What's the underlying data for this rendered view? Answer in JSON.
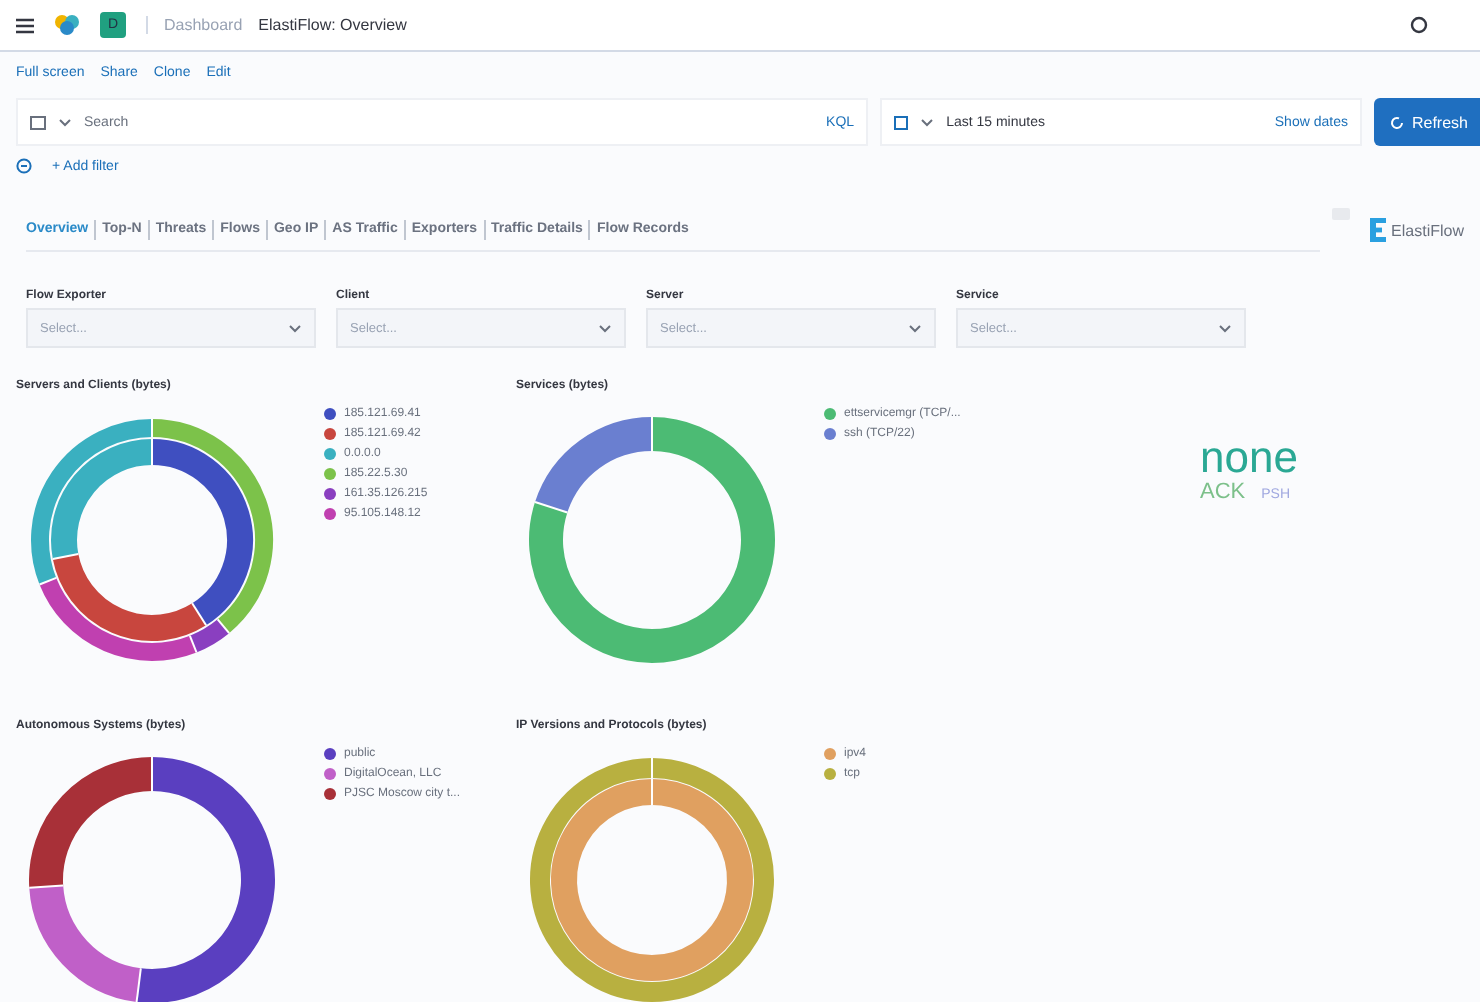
{
  "header": {
    "badge": "D",
    "breadcrumbs": [
      "Dashboard",
      "ElastiFlow: Overview"
    ]
  },
  "top_menu": [
    "Full screen",
    "Share",
    "Clone",
    "Edit"
  ],
  "query_bar": {
    "search_placeholder": "Search",
    "language": "KQL",
    "time_range": "Last 15 minutes",
    "show_dates": "Show dates",
    "refresh": "Refresh"
  },
  "filter_bar": {
    "add_filter": "+ Add filter"
  },
  "tabs": [
    {
      "label": "Overview",
      "selected": true
    },
    {
      "label": "Top-N",
      "selected": false
    },
    {
      "label": "Threats",
      "selected": false
    },
    {
      "label": "Flows",
      "selected": false
    },
    {
      "label": "Geo IP",
      "selected": false
    },
    {
      "label": "AS Traffic",
      "selected": false
    },
    {
      "label": "Exporters",
      "selected": false
    },
    {
      "label": "Traffic Details",
      "selected": false
    },
    {
      "label": "Flow Records",
      "selected": false
    }
  ],
  "brand": "ElastiFlow",
  "controls": [
    {
      "label": "Flow Exporter",
      "placeholder": "Select..."
    },
    {
      "label": "Client",
      "placeholder": "Select..."
    },
    {
      "label": "Server",
      "placeholder": "Select..."
    },
    {
      "label": "Service",
      "placeholder": "Select..."
    }
  ],
  "panels": [
    {
      "title": "Servers and Clients (bytes)",
      "legend": [
        {
          "label": "185.121.69.41",
          "color": "#3f4fc0"
        },
        {
          "label": "185.121.69.42",
          "color": "#c8463e"
        },
        {
          "label": "0.0.0.0",
          "color": "#3ab0c0"
        },
        {
          "label": "185.22.5.30",
          "color": "#7cc24a"
        },
        {
          "label": "161.35.126.215",
          "color": "#8a3fc0"
        },
        {
          "label": "95.105.148.12",
          "color": "#c040b0"
        }
      ]
    },
    {
      "title": "Services (bytes)",
      "legend": [
        {
          "label": "ettservicemgr (TCP/...",
          "color": "#4cbb74"
        },
        {
          "label": "ssh (TCP/22)",
          "color": "#6a7fd0"
        }
      ]
    },
    {
      "title": "Autonomous Systems (bytes)",
      "legend": [
        {
          "label": "public",
          "color": "#5a3fc0"
        },
        {
          "label": "DigitalOcean, LLC",
          "color": "#c060c8"
        },
        {
          "label": "PJSC Moscow city t...",
          "color": "#a83038"
        }
      ]
    },
    {
      "title": "IP Versions and Protocols (bytes)",
      "legend": [
        {
          "label": "ipv4",
          "color": "#e0a060"
        },
        {
          "label": "tcp",
          "color": "#b8b040"
        }
      ]
    }
  ],
  "tag_cloud": [
    {
      "text": "none",
      "kind": "large",
      "color": "#2aa894"
    },
    {
      "text": "ACK",
      "kind": "medium",
      "color": "#7cc08a"
    },
    {
      "text": "PSH",
      "kind": "small",
      "color": "#a0a8e0"
    }
  ]
}
